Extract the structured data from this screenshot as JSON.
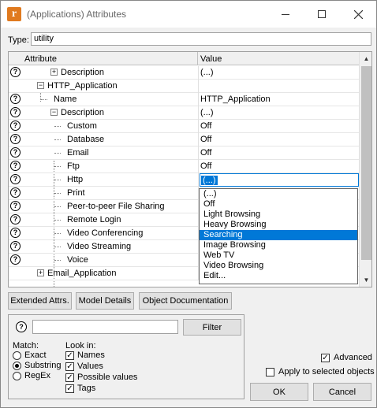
{
  "window": {
    "title": "(Applications) Attributes",
    "app_icon_letter": "r"
  },
  "type_field": {
    "label": "Type:",
    "value": "utility"
  },
  "grid": {
    "columns": [
      "Attribute",
      "Value"
    ],
    "rows": [
      {
        "label": "Description",
        "value": "(...)",
        "help": true,
        "expander": "+"
      },
      {
        "label": "HTTP_Application",
        "value": "",
        "help": false,
        "expander": "−"
      },
      {
        "label": "Name",
        "value": "HTTP_Application",
        "help": true,
        "expander": ""
      },
      {
        "label": "Description",
        "value": "(...)",
        "help": true,
        "expander": "−"
      },
      {
        "label": "Custom",
        "value": "Off",
        "help": true,
        "expander": ""
      },
      {
        "label": "Database",
        "value": "Off",
        "help": true,
        "expander": ""
      },
      {
        "label": "Email",
        "value": "Off",
        "help": true,
        "expander": ""
      },
      {
        "label": "Ftp",
        "value": "Off",
        "help": true,
        "expander": ""
      },
      {
        "label": "Http",
        "value": "(...)",
        "help": true,
        "expander": ""
      },
      {
        "label": "Print",
        "value": "",
        "help": true,
        "expander": ""
      },
      {
        "label": "Peer-to-peer File Sharing",
        "value": "",
        "help": true,
        "expander": ""
      },
      {
        "label": "Remote Login",
        "value": "",
        "help": true,
        "expander": ""
      },
      {
        "label": "Video Conferencing",
        "value": "",
        "help": true,
        "expander": ""
      },
      {
        "label": "Video Streaming",
        "value": "",
        "help": true,
        "expander": ""
      },
      {
        "label": "Voice",
        "value": "",
        "help": true,
        "expander": ""
      },
      {
        "label": "Email_Application",
        "value": "",
        "help": false,
        "expander": "+"
      }
    ]
  },
  "dropdown": {
    "items": [
      "(...)",
      "Off",
      "Light Browsing",
      "Heavy Browsing",
      "Searching",
      "Image Browsing",
      "Web TV",
      "Video Browsing",
      "Edit..."
    ],
    "selected": "Searching"
  },
  "buttons": {
    "extended": "Extended Attrs.",
    "model_details": "Model Details",
    "object_doc": "Object Documentation",
    "filter": "Filter",
    "ok": "OK",
    "cancel": "Cancel"
  },
  "filter": {
    "input_value": "",
    "match_label": "Match:",
    "match_options": [
      {
        "label": "Exact",
        "selected": false
      },
      {
        "label": "Substring",
        "selected": true
      },
      {
        "label": "RegEx",
        "selected": false
      }
    ],
    "look_label": "Look in:",
    "look_options": [
      {
        "label": "Names",
        "checked": true
      },
      {
        "label": "Values",
        "checked": true
      },
      {
        "label": "Possible values",
        "checked": true
      },
      {
        "label": "Tags",
        "checked": true
      }
    ]
  },
  "options": {
    "advanced_label": "Advanced",
    "advanced_checked": true,
    "apply_selected_label": "Apply to selected objects",
    "apply_selected_checked": false
  },
  "colors": {
    "accent": "#0078d7",
    "window_bg": "#f0f0f0",
    "app_icon": "#e07a1f"
  }
}
